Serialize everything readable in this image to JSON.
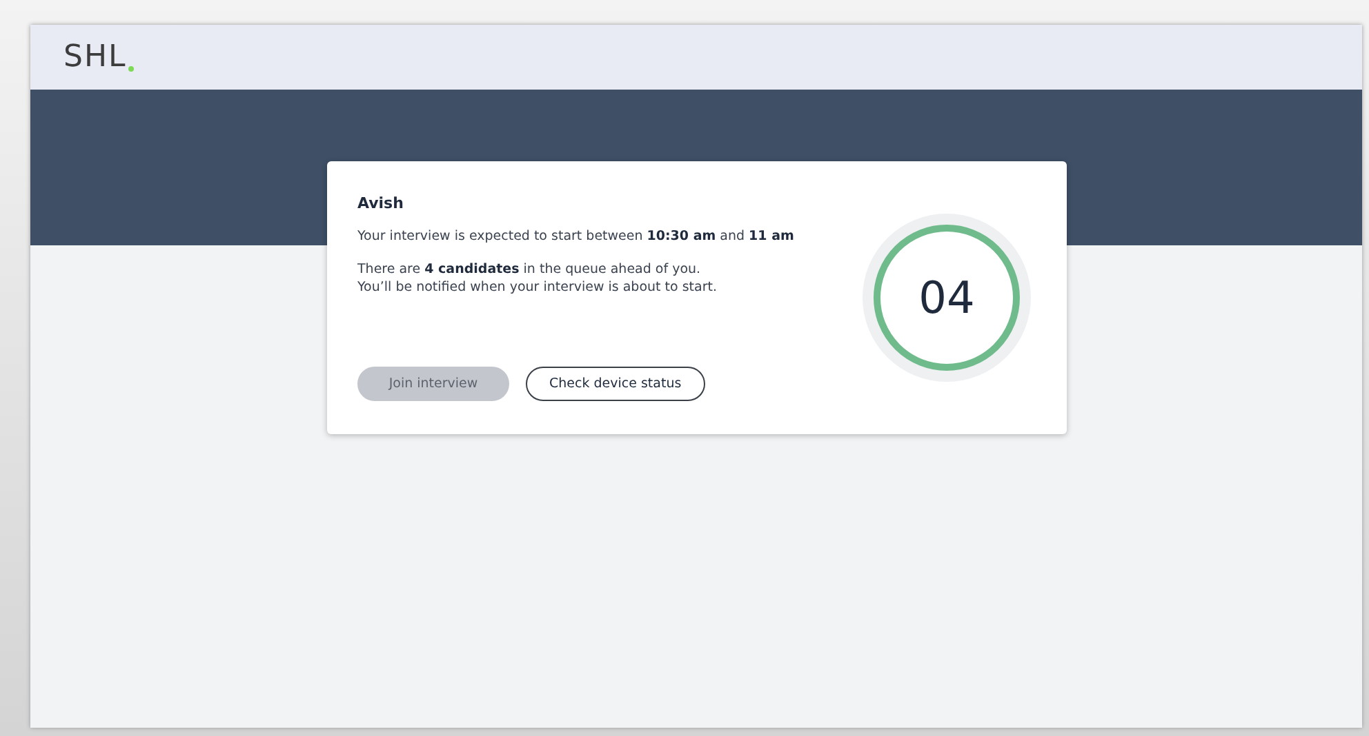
{
  "header": {
    "logo": "SHL"
  },
  "card": {
    "name": "Avish",
    "schedule": "Your interview is expected to start between **10:30 am** and **11 am**",
    "queue": [
      "There are **4 candidates** in the queue ahead of you.",
      "You’ll be notified when your interview is about to start."
    ],
    "buttons": [
      {
        "label": "Join interview",
        "kind": "primary",
        "disabled": true
      },
      {
        "label": "Check device status",
        "kind": "outline",
        "disabled": false
      }
    ],
    "counter": "04"
  }
}
